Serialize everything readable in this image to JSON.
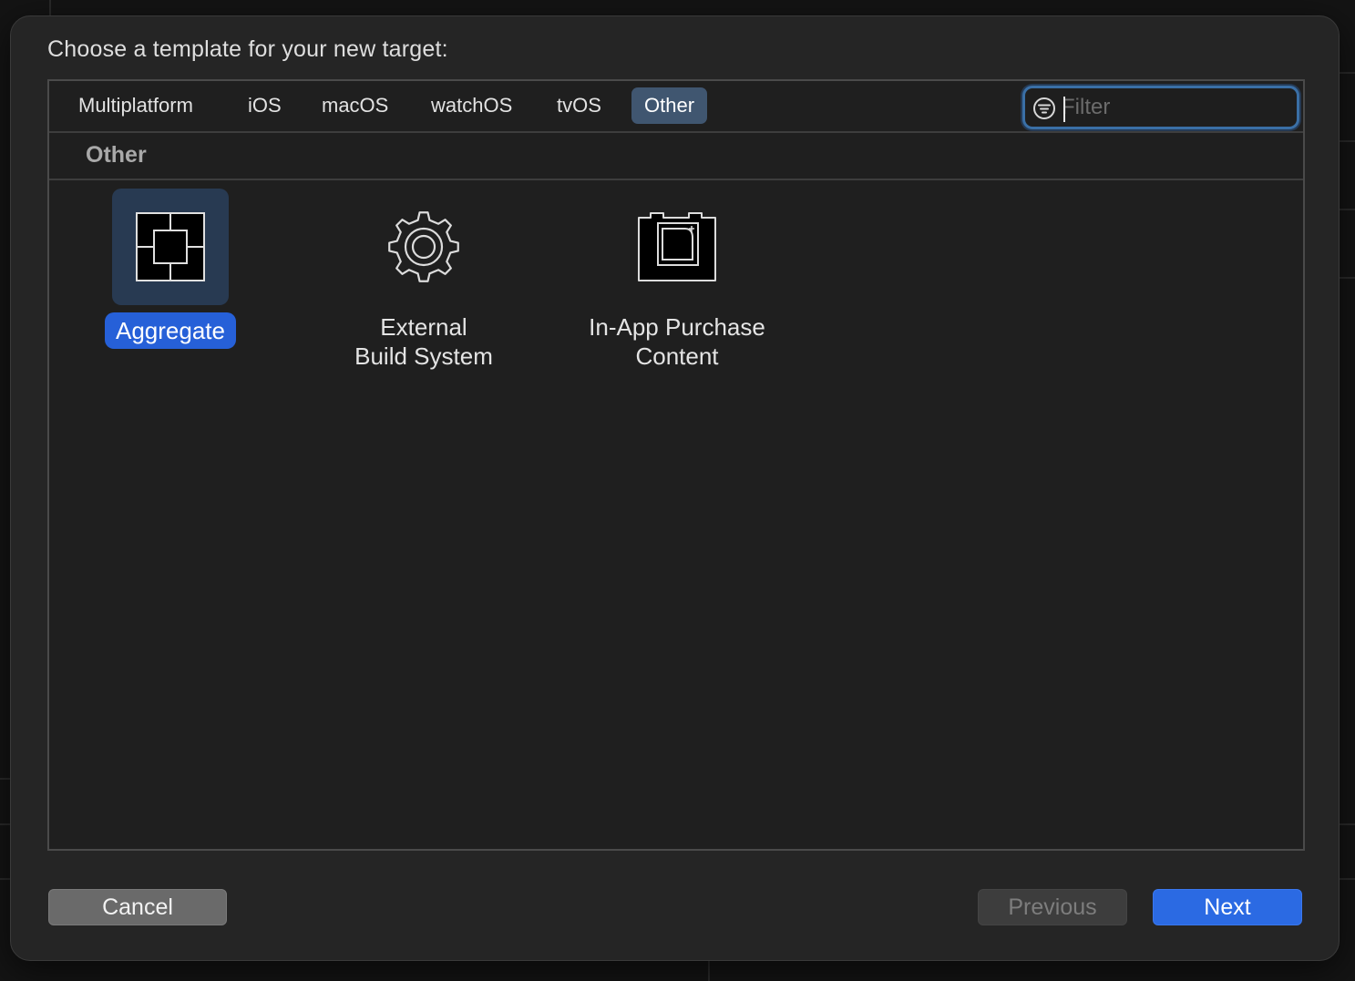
{
  "dialog": {
    "title": "Choose a template for your new target:"
  },
  "tabs": [
    {
      "label": "Multiplatform",
      "selected": false
    },
    {
      "label": "iOS",
      "selected": false
    },
    {
      "label": "macOS",
      "selected": false
    },
    {
      "label": "watchOS",
      "selected": false
    },
    {
      "label": "tvOS",
      "selected": false
    },
    {
      "label": "Other",
      "selected": true
    }
  ],
  "filter": {
    "placeholder": "Filter",
    "value": "",
    "icon": "filter-icon"
  },
  "section": {
    "title": "Other"
  },
  "templates": [
    {
      "label": "Aggregate",
      "icon": "aggregate-icon",
      "selected": true
    },
    {
      "label": "External\nBuild System",
      "line1": "External",
      "line2": "Build System",
      "icon": "gear-icon",
      "selected": false
    },
    {
      "label": "In-App Purchase\nContent",
      "line1": "In-App Purchase",
      "line2": "Content",
      "icon": "in-app-purchase-icon",
      "selected": false
    }
  ],
  "buttons": {
    "cancel": "Cancel",
    "previous": "Previous",
    "next": "Next"
  },
  "colors": {
    "accent": "#2b6ae3",
    "selected_tab": "#405670",
    "selection_bg": "#283a52"
  }
}
